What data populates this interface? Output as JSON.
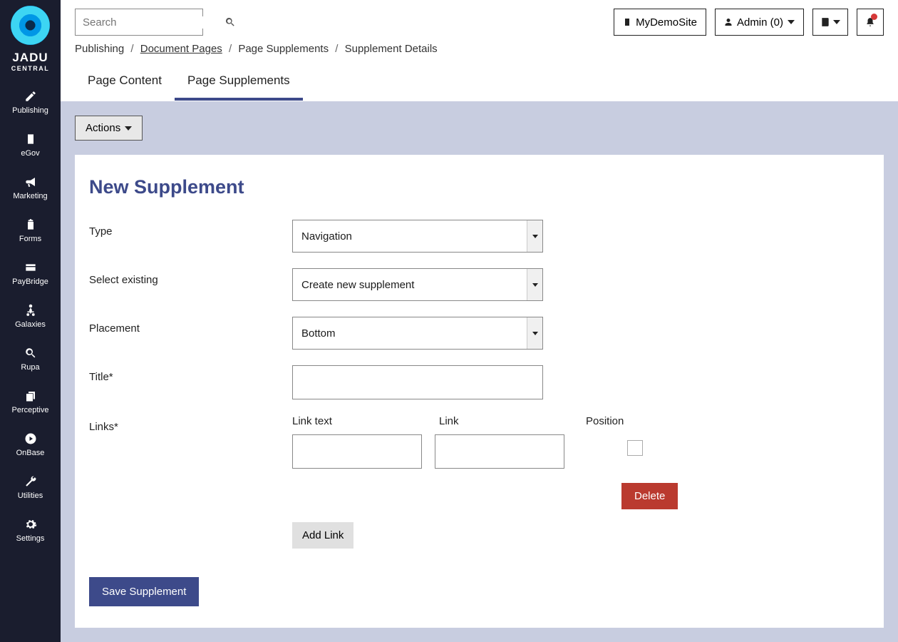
{
  "logo": {
    "brand": "JADU",
    "sub": "CENTRAL"
  },
  "sidebar": {
    "items": [
      {
        "label": "Publishing",
        "icon": "pencil"
      },
      {
        "label": "eGov",
        "icon": "building"
      },
      {
        "label": "Marketing",
        "icon": "bullhorn"
      },
      {
        "label": "Forms",
        "icon": "clipboard"
      },
      {
        "label": "PayBridge",
        "icon": "card"
      },
      {
        "label": "Galaxies",
        "icon": "sitemap"
      },
      {
        "label": "Rupa",
        "icon": "search"
      },
      {
        "label": "Perceptive",
        "icon": "copy"
      },
      {
        "label": "OnBase",
        "icon": "play-circle"
      },
      {
        "label": "Utilities",
        "icon": "wrench"
      },
      {
        "label": "Settings",
        "icon": "gear"
      }
    ]
  },
  "topbar": {
    "search_placeholder": "Search",
    "site_label": "MyDemoSite",
    "user_label": "Admin (0)"
  },
  "breadcrumb": {
    "items": [
      {
        "label": "Publishing",
        "link": false
      },
      {
        "label": "Document Pages",
        "link": true
      },
      {
        "label": "Page Supplements",
        "link": false
      },
      {
        "label": "Supplement Details",
        "link": false
      }
    ]
  },
  "tabs": [
    {
      "label": "Page Content",
      "active": false
    },
    {
      "label": "Page Supplements",
      "active": true
    }
  ],
  "actions_label": "Actions",
  "panel": {
    "title": "New Supplement",
    "fields": {
      "type_label": "Type",
      "type_value": "Navigation",
      "select_existing_label": "Select existing",
      "select_existing_value": "Create new supplement",
      "placement_label": "Placement",
      "placement_value": "Bottom",
      "title_label": "Title*",
      "title_value": "",
      "links_label": "Links*",
      "links_cols": {
        "link_text": "Link text",
        "link": "Link",
        "position": "Position"
      },
      "link_text_value": "",
      "link_value": "",
      "delete_label": "Delete",
      "add_link_label": "Add Link"
    },
    "save_label": "Save Supplement"
  }
}
